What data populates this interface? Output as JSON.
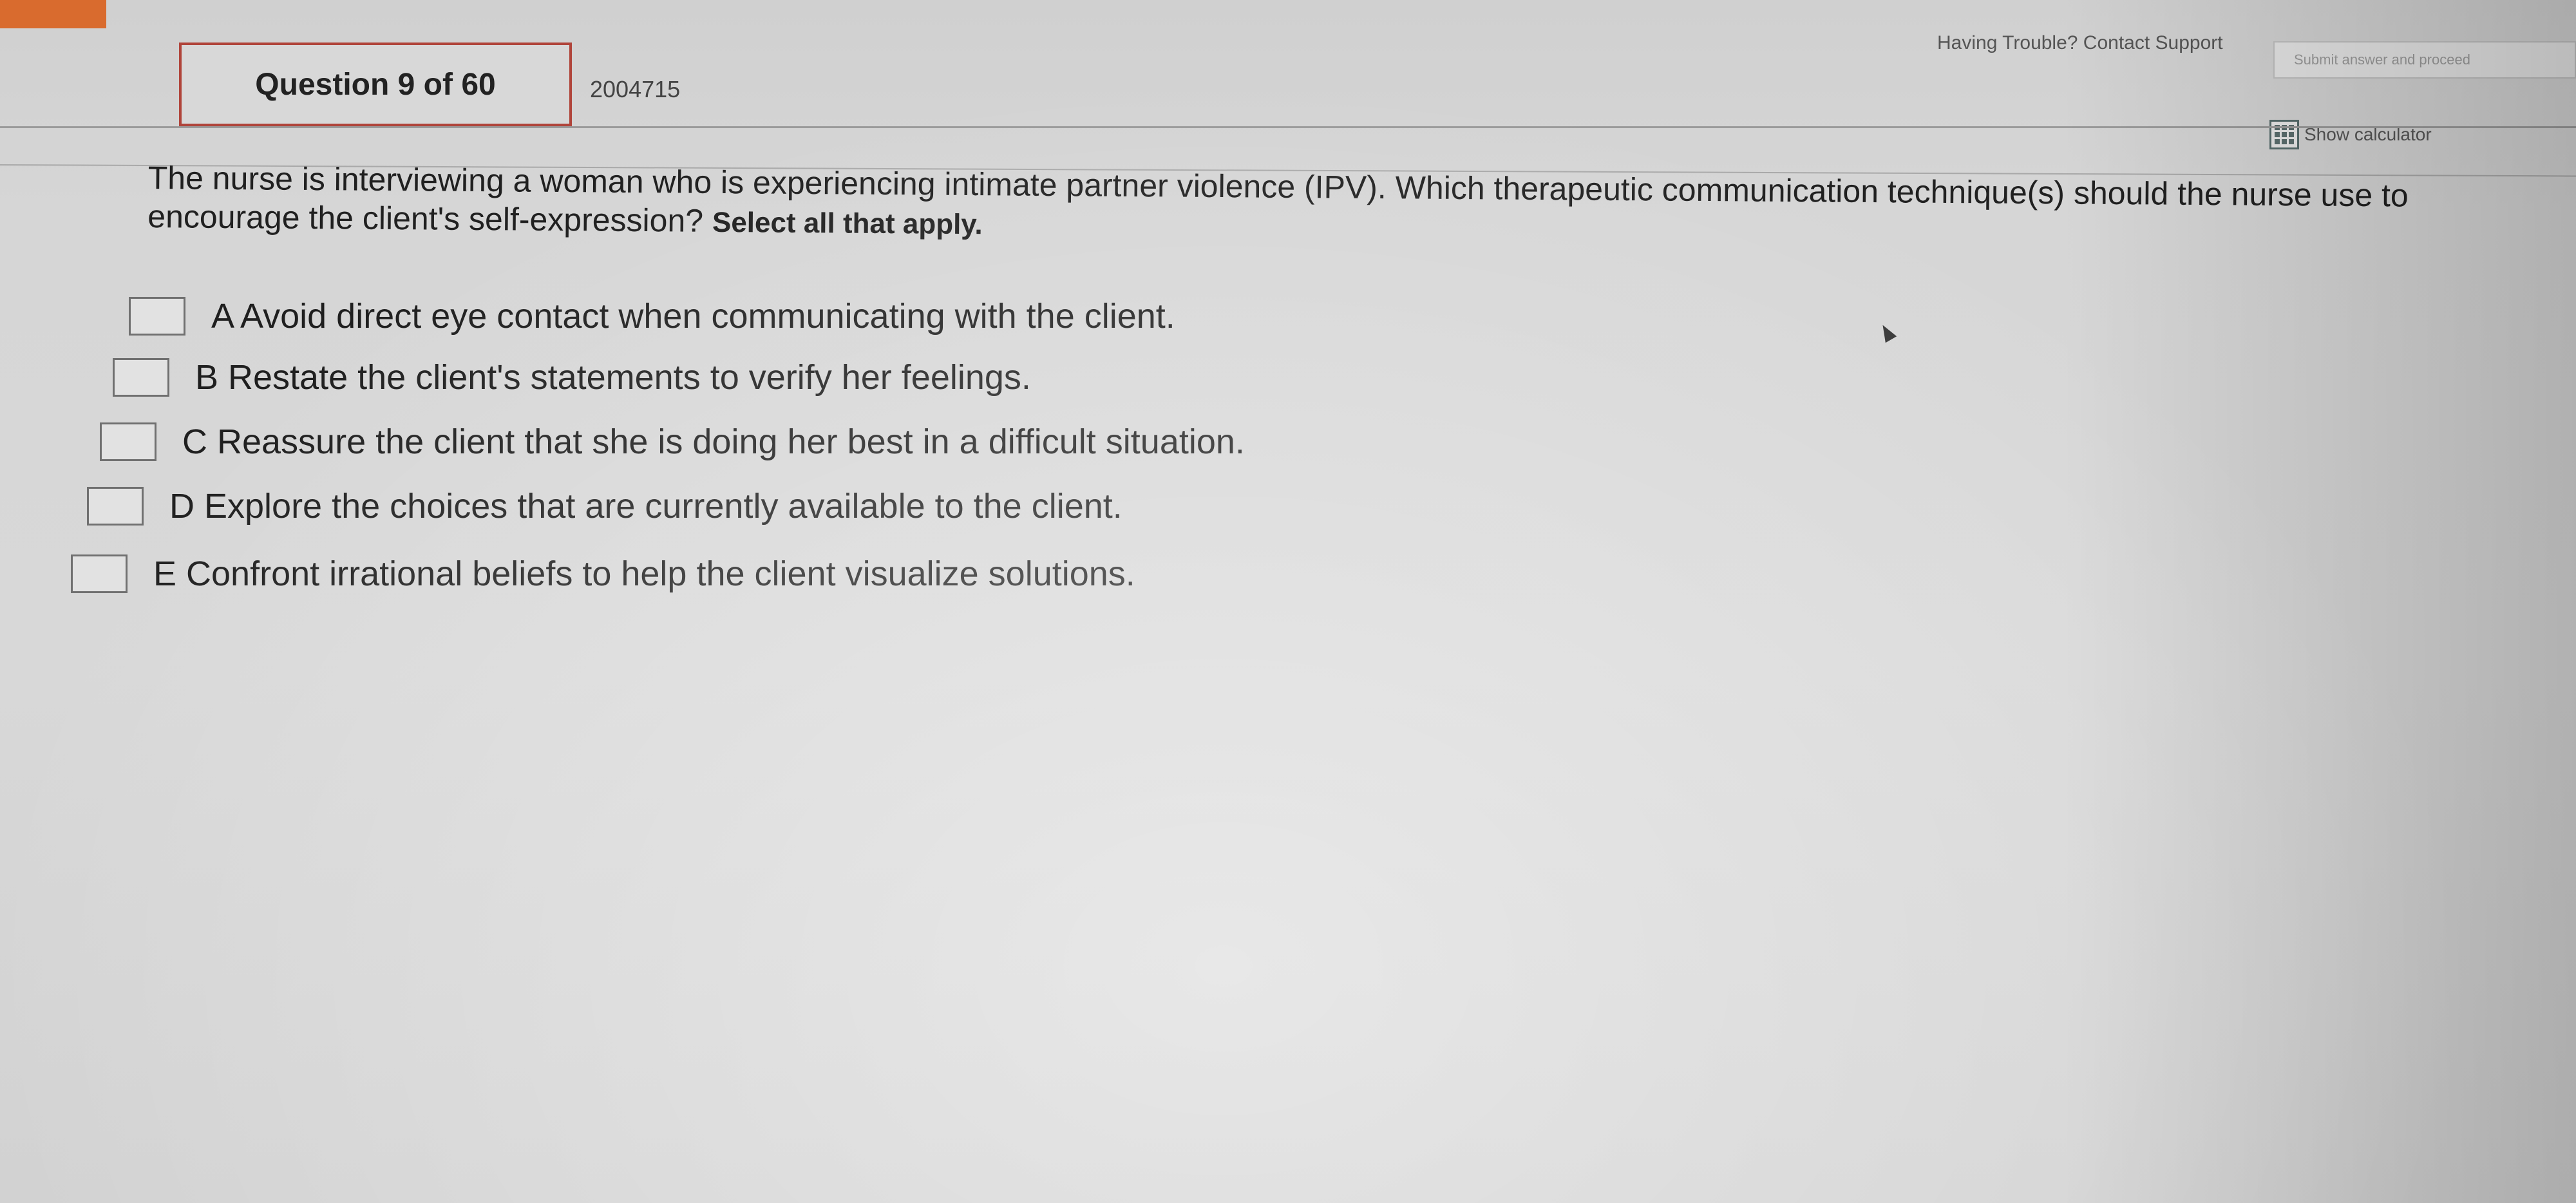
{
  "header": {
    "question_label": "Question 9 of 60",
    "question_id": "2004715",
    "support_text": "Having Trouble? Contact Support",
    "submit_label": "Submit answer and proceed",
    "calculator_label": "Show calculator"
  },
  "question": {
    "stem": "The nurse is interviewing a woman who is experiencing intimate partner violence (IPV). Which therapeutic communication technique(s) should the nurse use to encourage the client's self-expression? ",
    "instruction": "Select all that apply.",
    "options": [
      {
        "text": "A Avoid direct eye contact when communicating with the client.",
        "checked": false
      },
      {
        "text": "B Restate the client's statements to verify her feelings.",
        "checked": false
      },
      {
        "text": "C Reassure the client that she is doing her best in a difficult situation.",
        "checked": false
      },
      {
        "text": "D Explore the choices that are currently available to the client.",
        "checked": false
      },
      {
        "text": "E Confront irrational beliefs to help the client visualize solutions.",
        "checked": false
      }
    ]
  },
  "colors": {
    "accent_tab": "#d96b2e",
    "question_box_border": "#b0443a"
  },
  "icons": {
    "calculator": "calculator-icon",
    "pointer": "mouse-cursor-icon"
  }
}
